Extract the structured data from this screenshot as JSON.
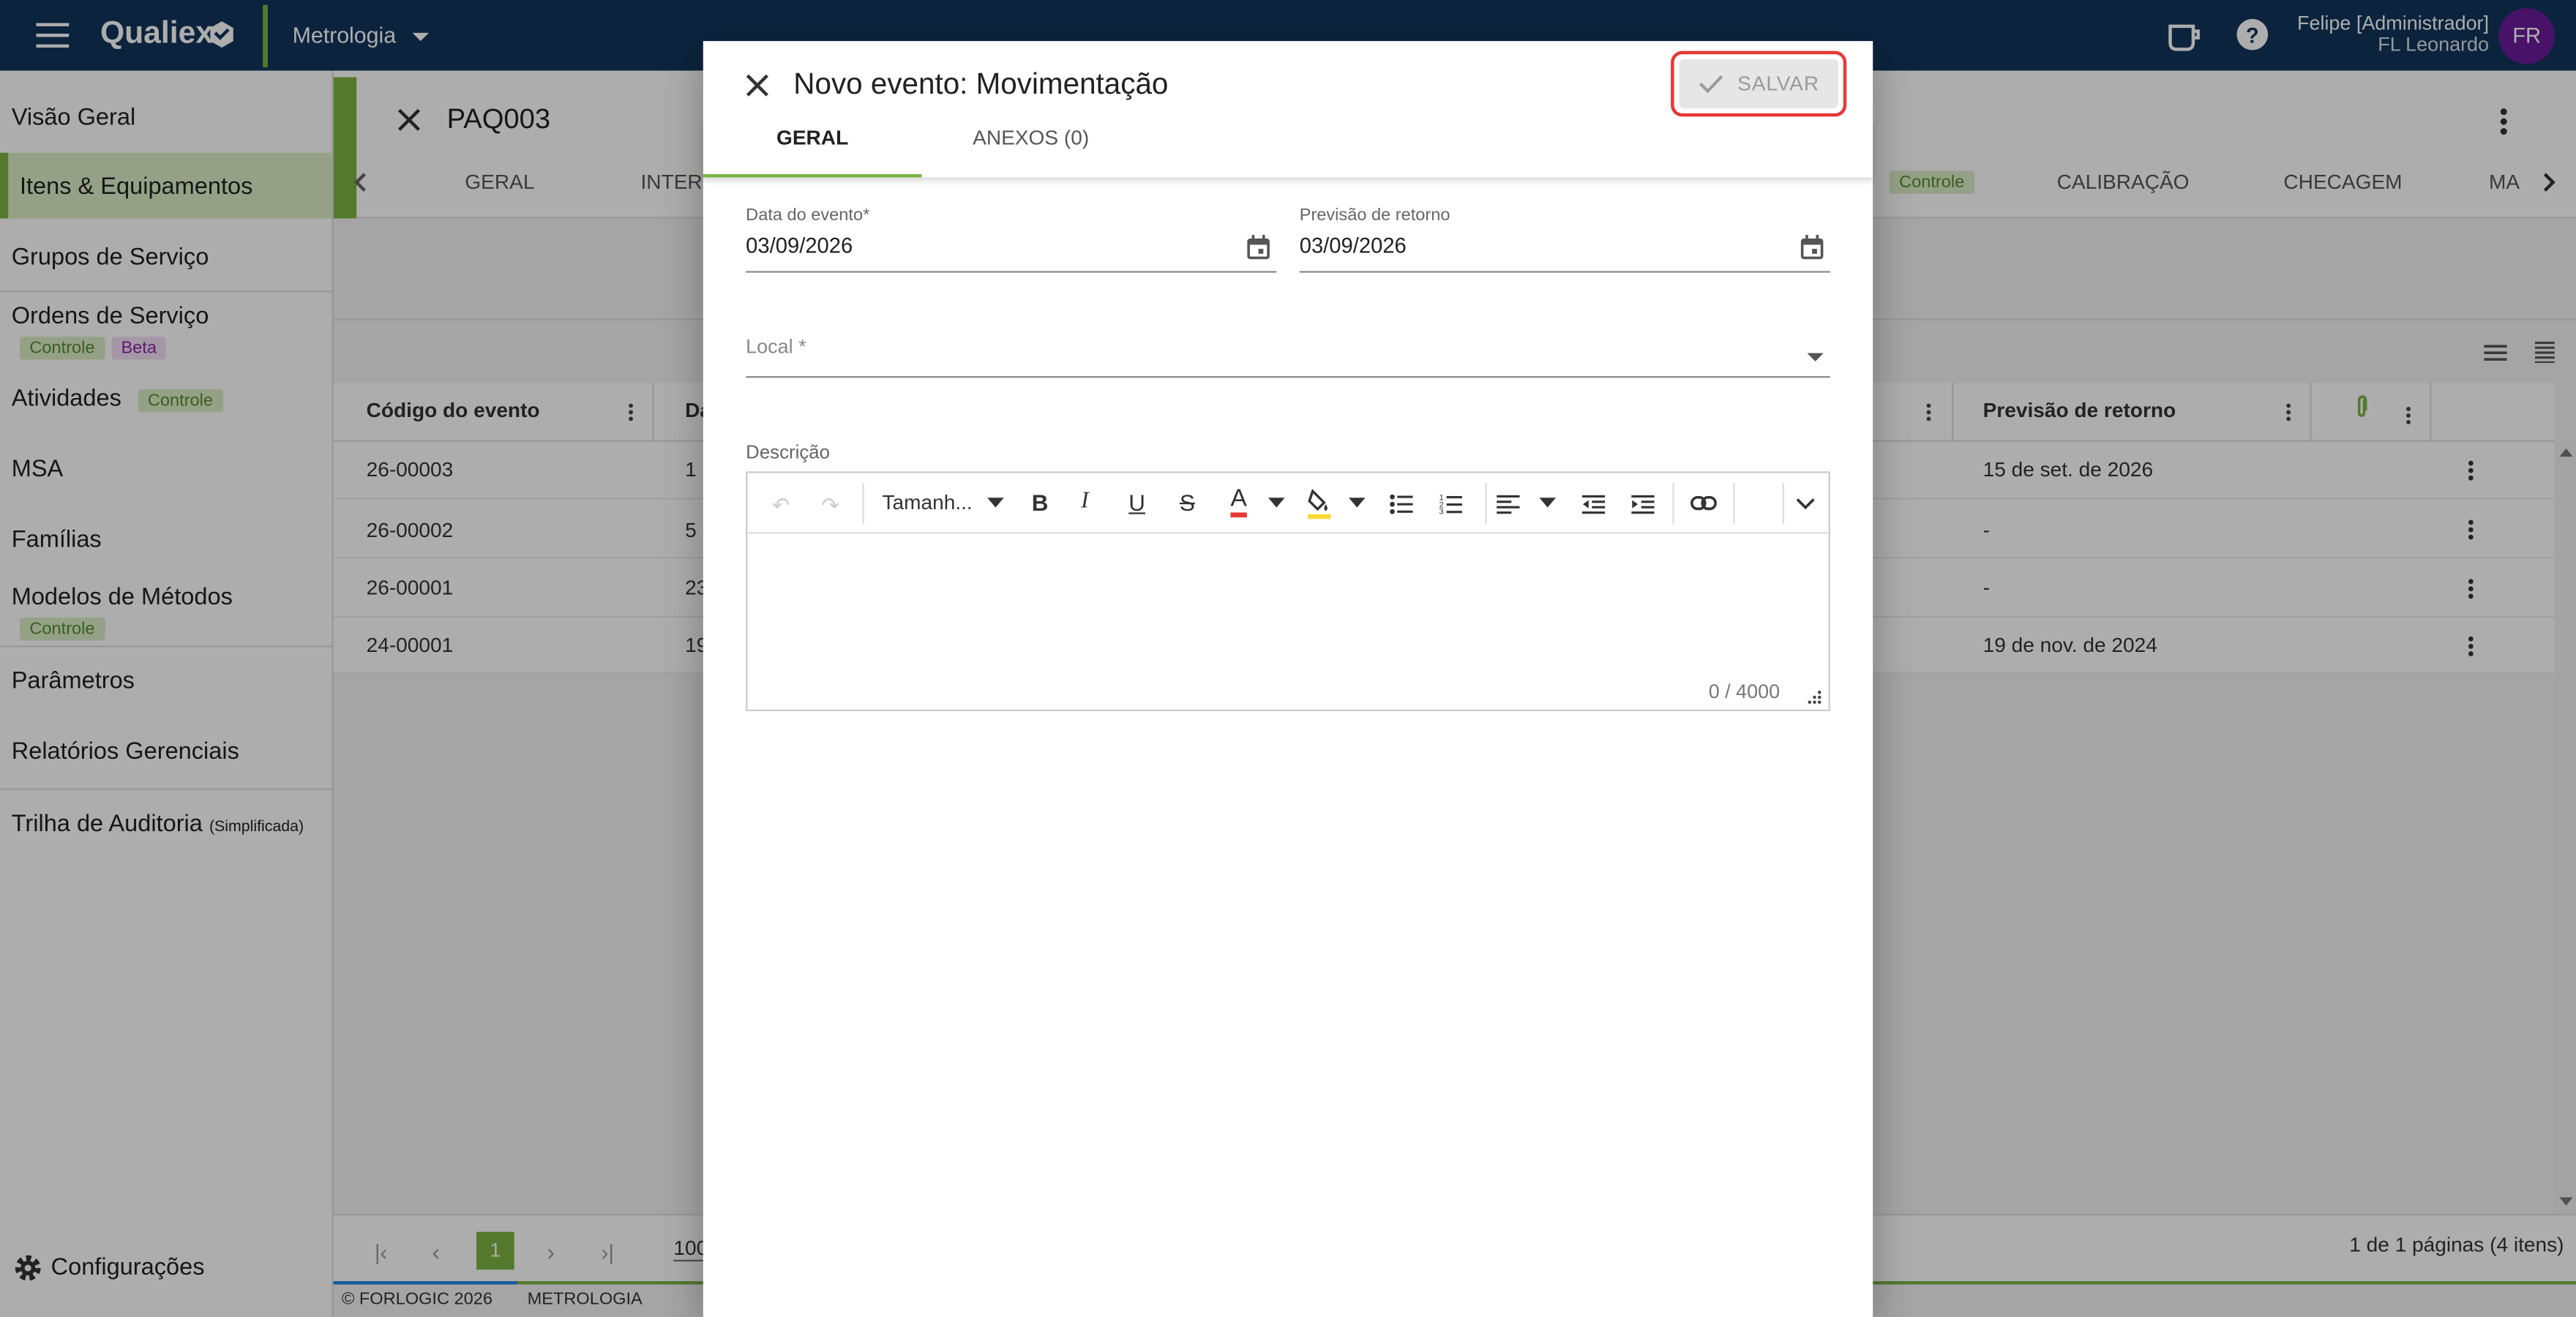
{
  "app": {
    "brand": "Qualiex",
    "module": "Metrologia"
  },
  "user": {
    "name": "Felipe [Administrador]",
    "company": "FL Leonardo",
    "initials": "FR"
  },
  "sidebar": {
    "items": [
      {
        "label": "Visão Geral"
      },
      {
        "label": "Itens & Equipamentos"
      },
      {
        "label": "Grupos de Serviço"
      },
      {
        "label": "Ordens de Serviço",
        "tags": [
          "Controle",
          "Beta"
        ]
      },
      {
        "label": "Atividades",
        "tags": [
          "Controle"
        ]
      },
      {
        "label": "MSA"
      },
      {
        "label": "Famílias"
      },
      {
        "label": "Modelos de Métodos",
        "tags": [
          "Controle"
        ]
      },
      {
        "label": "Parâmetros"
      },
      {
        "label": "Relatórios Gerenciais"
      },
      {
        "label": "Trilha de Auditoria",
        "suffix": "(Simplificada)"
      }
    ],
    "settings": "Configurações"
  },
  "record": {
    "title": "PAQ003",
    "tabs": [
      "GERAL",
      "INTER",
      "Controle",
      "CALIBRAÇÃO",
      "CHECAGEM",
      "MA"
    ]
  },
  "table": {
    "columns": [
      "Código do evento",
      "Da",
      "Previsão de retorno"
    ],
    "rows": [
      {
        "code": "26-00003",
        "date": "1",
        "return": "15 de set. de 2026"
      },
      {
        "code": "26-00002",
        "date": "5",
        "return": "-"
      },
      {
        "code": "26-00001",
        "date": "23",
        "return": "-"
      },
      {
        "code": "24-00001",
        "date": "19",
        "return": "19 de nov. de 2024"
      }
    ]
  },
  "pagination": {
    "current": "1",
    "page_size": "100",
    "summary": "1 de 1 páginas (4 itens)"
  },
  "footer": {
    "copyright": "© FORLOGIC 2026",
    "module": "METROLOGIA"
  },
  "dialog": {
    "title": "Novo evento: Movimentação",
    "save_label": "SALVAR",
    "tabs": [
      "GERAL",
      "ANEXOS (0)"
    ],
    "event_date": {
      "label": "Data do evento*",
      "value": "03/09/2026"
    },
    "return_date": {
      "label": "Previsão de retorno",
      "value": "03/09/2026"
    },
    "location": {
      "label": "Local *"
    },
    "description": {
      "label": "Descrição",
      "font_size_placeholder": "Tamanh...",
      "counter": "0 / 4000"
    }
  },
  "colors": {
    "topbar": "#12345a",
    "accent": "#7cb342",
    "avatar": "#6a1b9a",
    "highlight": "#e53935"
  }
}
